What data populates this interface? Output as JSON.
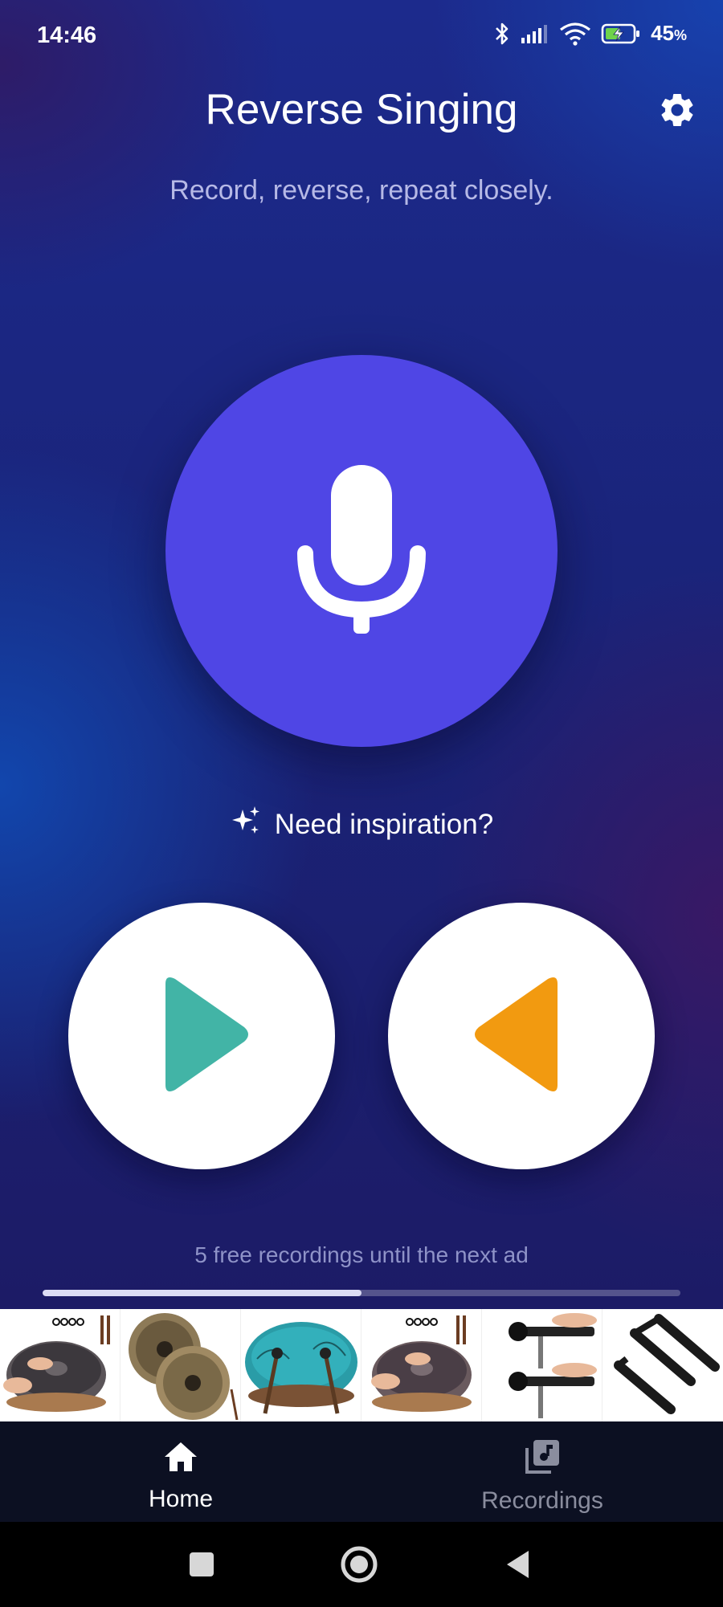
{
  "status_bar": {
    "time": "14:46",
    "battery": "45",
    "battery_unit": "%",
    "icons": [
      "bluetooth-icon",
      "signal-icon",
      "wifi-icon",
      "battery-charging-icon"
    ]
  },
  "header": {
    "title": "Reverse Singing",
    "subtitle": "Record, reverse, repeat closely.",
    "settings_icon": "gear-icon"
  },
  "record": {
    "icon": "microphone-icon",
    "color": "#4f46e5"
  },
  "inspiration": {
    "label": "Need inspiration?",
    "icon": "sparkles-icon"
  },
  "playback": {
    "play_icon": "play-icon",
    "play_color": "#42b4a6",
    "reverse_icon": "reverse-play-icon",
    "reverse_color": "#f29a10"
  },
  "ad_counter": {
    "text": "5 free recordings until the next ad",
    "progress": 0.5
  },
  "ad_banner": {
    "items": [
      "handpan-drum",
      "steel-tongue-drums",
      "teal-tongue-drum",
      "handpan-drum",
      "workout-bench",
      "resistance-handles"
    ]
  },
  "bottom_nav": {
    "items": [
      {
        "label": "Home",
        "icon": "home-icon",
        "active": true
      },
      {
        "label": "Recordings",
        "icon": "library-music-icon",
        "active": false
      }
    ]
  },
  "system_nav": {
    "buttons": [
      "recents-icon",
      "home-circle-icon",
      "back-icon"
    ]
  }
}
